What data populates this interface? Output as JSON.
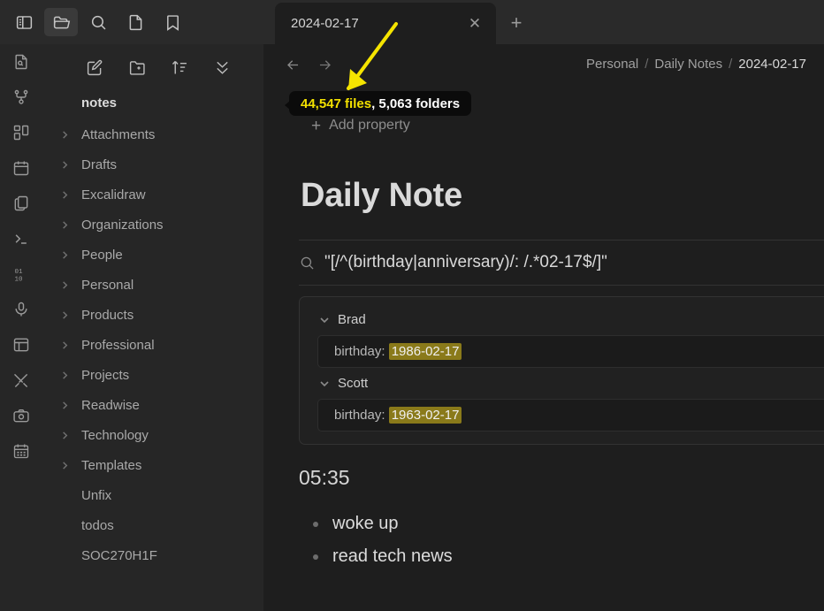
{
  "window": {
    "title": "2024-02-17"
  },
  "toprail": {
    "items": [
      {
        "name": "toggle-sidebar-icon",
        "label": "Toggle sidebar",
        "active": false
      },
      {
        "name": "folder-icon",
        "label": "Files",
        "active": true
      },
      {
        "name": "search-icon",
        "label": "Search",
        "active": false
      },
      {
        "name": "file-icon",
        "label": "All files",
        "active": false
      },
      {
        "name": "bookmark-icon",
        "label": "Bookmarks",
        "active": false
      }
    ]
  },
  "tabs": {
    "items": [
      {
        "label": "2024-02-17",
        "active": true
      }
    ],
    "close_label": "✕",
    "new_tab_label": "+"
  },
  "rail": {
    "items": [
      {
        "name": "file-search-icon",
        "label": "Search in file"
      },
      {
        "name": "graph-icon",
        "label": "Graph view"
      },
      {
        "name": "dashboard-icon",
        "label": "Dashboard"
      },
      {
        "name": "calendar-icon",
        "label": "Calendar"
      },
      {
        "name": "copy-files-icon",
        "label": "Copy files"
      },
      {
        "name": "terminal-icon",
        "label": "Terminal"
      },
      {
        "name": "binary-icon",
        "label": "Binary"
      },
      {
        "name": "microphone-icon",
        "label": "Audio recorder"
      },
      {
        "name": "layout-icon",
        "label": "Layout"
      },
      {
        "name": "tools-icon",
        "label": "Tools"
      },
      {
        "name": "camera-icon",
        "label": "Camera"
      },
      {
        "name": "calendar-days-icon",
        "label": "Periodic notes"
      }
    ]
  },
  "explorer": {
    "toolbar": [
      {
        "name": "new-note-icon",
        "label": "New note"
      },
      {
        "name": "new-folder-icon",
        "label": "New folder"
      },
      {
        "name": "sort-icon",
        "label": "Change sort order"
      },
      {
        "name": "collapse-all-icon",
        "label": "Collapse all"
      }
    ],
    "vault_name": "notes",
    "tree": [
      {
        "label": "Attachments",
        "folder": true
      },
      {
        "label": "Drafts",
        "folder": true
      },
      {
        "label": "Excalidraw",
        "folder": true
      },
      {
        "label": "Organizations",
        "folder": true
      },
      {
        "label": "People",
        "folder": true
      },
      {
        "label": "Personal",
        "folder": true
      },
      {
        "label": "Products",
        "folder": true
      },
      {
        "label": "Professional",
        "folder": true
      },
      {
        "label": "Projects",
        "folder": true
      },
      {
        "label": "Readwise",
        "folder": true
      },
      {
        "label": "Technology",
        "folder": true
      },
      {
        "label": "Templates",
        "folder": true
      },
      {
        "label": "Unfix",
        "folder": false
      },
      {
        "label": "todos",
        "folder": false
      },
      {
        "label": "SOC270H1F",
        "folder": false
      }
    ]
  },
  "main": {
    "nav": {
      "back_label": "←",
      "forward_label": "→"
    },
    "breadcrumb": {
      "segments": [
        "Personal",
        "Daily Notes",
        "2024-02-17"
      ],
      "separator": "/"
    },
    "properties": {
      "add_property_label": "Add property",
      "add_property_plus": "+"
    },
    "note_title": "Daily Note",
    "query": {
      "icon": "search-icon",
      "text": "\"[/^(birthday|anniversary)/: /.*02-17$/]\""
    },
    "results": [
      {
        "group": "Brad",
        "lines": [
          {
            "key": "birthday:",
            "value": "1986-02-17"
          }
        ]
      },
      {
        "group": "Scott",
        "lines": [
          {
            "key": "birthday:",
            "value": "1963-02-17"
          }
        ]
      }
    ],
    "time_heading": "05:35",
    "bullets": [
      "woke up",
      "read tech news"
    ]
  },
  "annotation": {
    "tooltip_files": "44,547 files",
    "tooltip_rest": ", 5,063 folders",
    "arrow_color": "#f5e400"
  },
  "colors": {
    "accent_yellow": "#f2e000",
    "highlight": "#8a7a1a",
    "background": "#1e1e1e",
    "panel": "#262626"
  }
}
